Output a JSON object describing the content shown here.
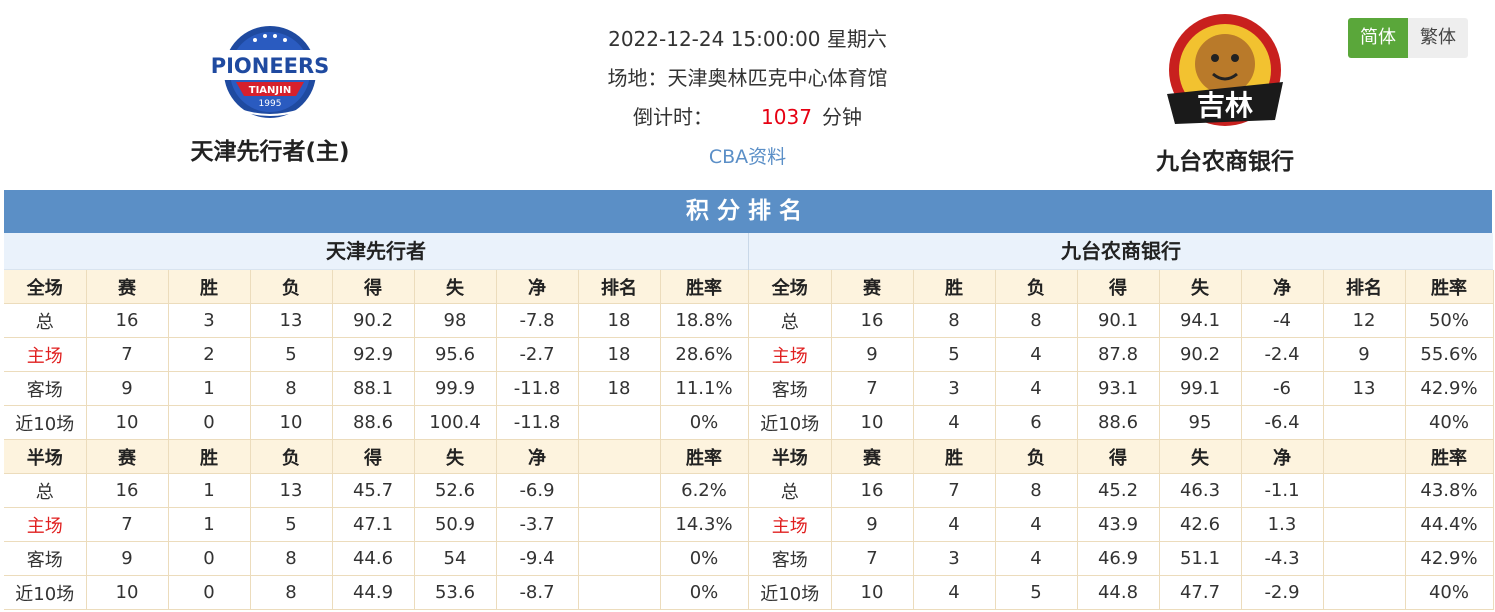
{
  "match": {
    "datetime": "2022-12-24 15:00:00 星期六",
    "venue": "场地：天津奥林匹克中心体育馆",
    "countdown_label": "倒计时：",
    "countdown_value": "1037",
    "countdown_unit": "分钟",
    "link_text": "CBA资料"
  },
  "home_team": {
    "name": "天津先行者(主)",
    "short_name": "天津先行者",
    "logo": {
      "text_top": "PIONEERS",
      "text_mid": "TIANJIN",
      "text_year": "1995",
      "icon": "pioneers-logo"
    }
  },
  "away_team": {
    "name": "九台农商银行",
    "logo": {
      "text_main": "吉林",
      "icon": "tigers-logo"
    }
  },
  "language": {
    "simplified": "简体",
    "traditional": "繁体"
  },
  "standings": {
    "title": "积分排名",
    "left": {
      "team": "天津先行者",
      "full_header": [
        "全场",
        "赛",
        "胜",
        "负",
        "得",
        "失",
        "净",
        "排名",
        "胜率"
      ],
      "full_rows": [
        [
          "总",
          "16",
          "3",
          "13",
          "90.2",
          "98",
          "-7.8",
          "18",
          "18.8%"
        ],
        [
          "主场",
          "7",
          "2",
          "5",
          "92.9",
          "95.6",
          "-2.7",
          "18",
          "28.6%"
        ],
        [
          "客场",
          "9",
          "1",
          "8",
          "88.1",
          "99.9",
          "-11.8",
          "18",
          "11.1%"
        ],
        [
          "近10场",
          "10",
          "0",
          "10",
          "88.6",
          "100.4",
          "-11.8",
          "",
          "0%"
        ]
      ],
      "half_header": [
        "半场",
        "赛",
        "胜",
        "负",
        "得",
        "失",
        "净",
        "",
        "胜率"
      ],
      "half_rows": [
        [
          "总",
          "16",
          "1",
          "13",
          "45.7",
          "52.6",
          "-6.9",
          "",
          "6.2%"
        ],
        [
          "主场",
          "7",
          "1",
          "5",
          "47.1",
          "50.9",
          "-3.7",
          "",
          "14.3%"
        ],
        [
          "客场",
          "9",
          "0",
          "8",
          "44.6",
          "54",
          "-9.4",
          "",
          "0%"
        ],
        [
          "近10场",
          "10",
          "0",
          "8",
          "44.9",
          "53.6",
          "-8.7",
          "",
          "0%"
        ]
      ]
    },
    "right": {
      "team": "九台农商银行",
      "full_header": [
        "全场",
        "赛",
        "胜",
        "负",
        "得",
        "失",
        "净",
        "排名",
        "胜率"
      ],
      "full_rows": [
        [
          "总",
          "16",
          "8",
          "8",
          "90.1",
          "94.1",
          "-4",
          "12",
          "50%"
        ],
        [
          "主场",
          "9",
          "5",
          "4",
          "87.8",
          "90.2",
          "-2.4",
          "9",
          "55.6%"
        ],
        [
          "客场",
          "7",
          "3",
          "4",
          "93.1",
          "99.1",
          "-6",
          "13",
          "42.9%"
        ],
        [
          "近10场",
          "10",
          "4",
          "6",
          "88.6",
          "95",
          "-6.4",
          "",
          "40%"
        ]
      ],
      "half_header": [
        "半场",
        "赛",
        "胜",
        "负",
        "得",
        "失",
        "净",
        "",
        "胜率"
      ],
      "half_rows": [
        [
          "总",
          "16",
          "7",
          "8",
          "45.2",
          "46.3",
          "-1.1",
          "",
          "43.8%"
        ],
        [
          "主场",
          "9",
          "4",
          "4",
          "43.9",
          "42.6",
          "1.3",
          "",
          "44.4%"
        ],
        [
          "客场",
          "7",
          "3",
          "4",
          "46.9",
          "51.1",
          "-4.3",
          "",
          "42.9%"
        ],
        [
          "近10场",
          "10",
          "4",
          "5",
          "44.8",
          "47.7",
          "-2.9",
          "",
          "40%"
        ]
      ]
    }
  },
  "colors": {
    "title_bar": "#5b8fc6",
    "header_row": "#fdf3de",
    "home_label": "#e02020",
    "countdown": "#e60012",
    "active_lang": "#5aa73a",
    "link": "#5b8fc7"
  }
}
